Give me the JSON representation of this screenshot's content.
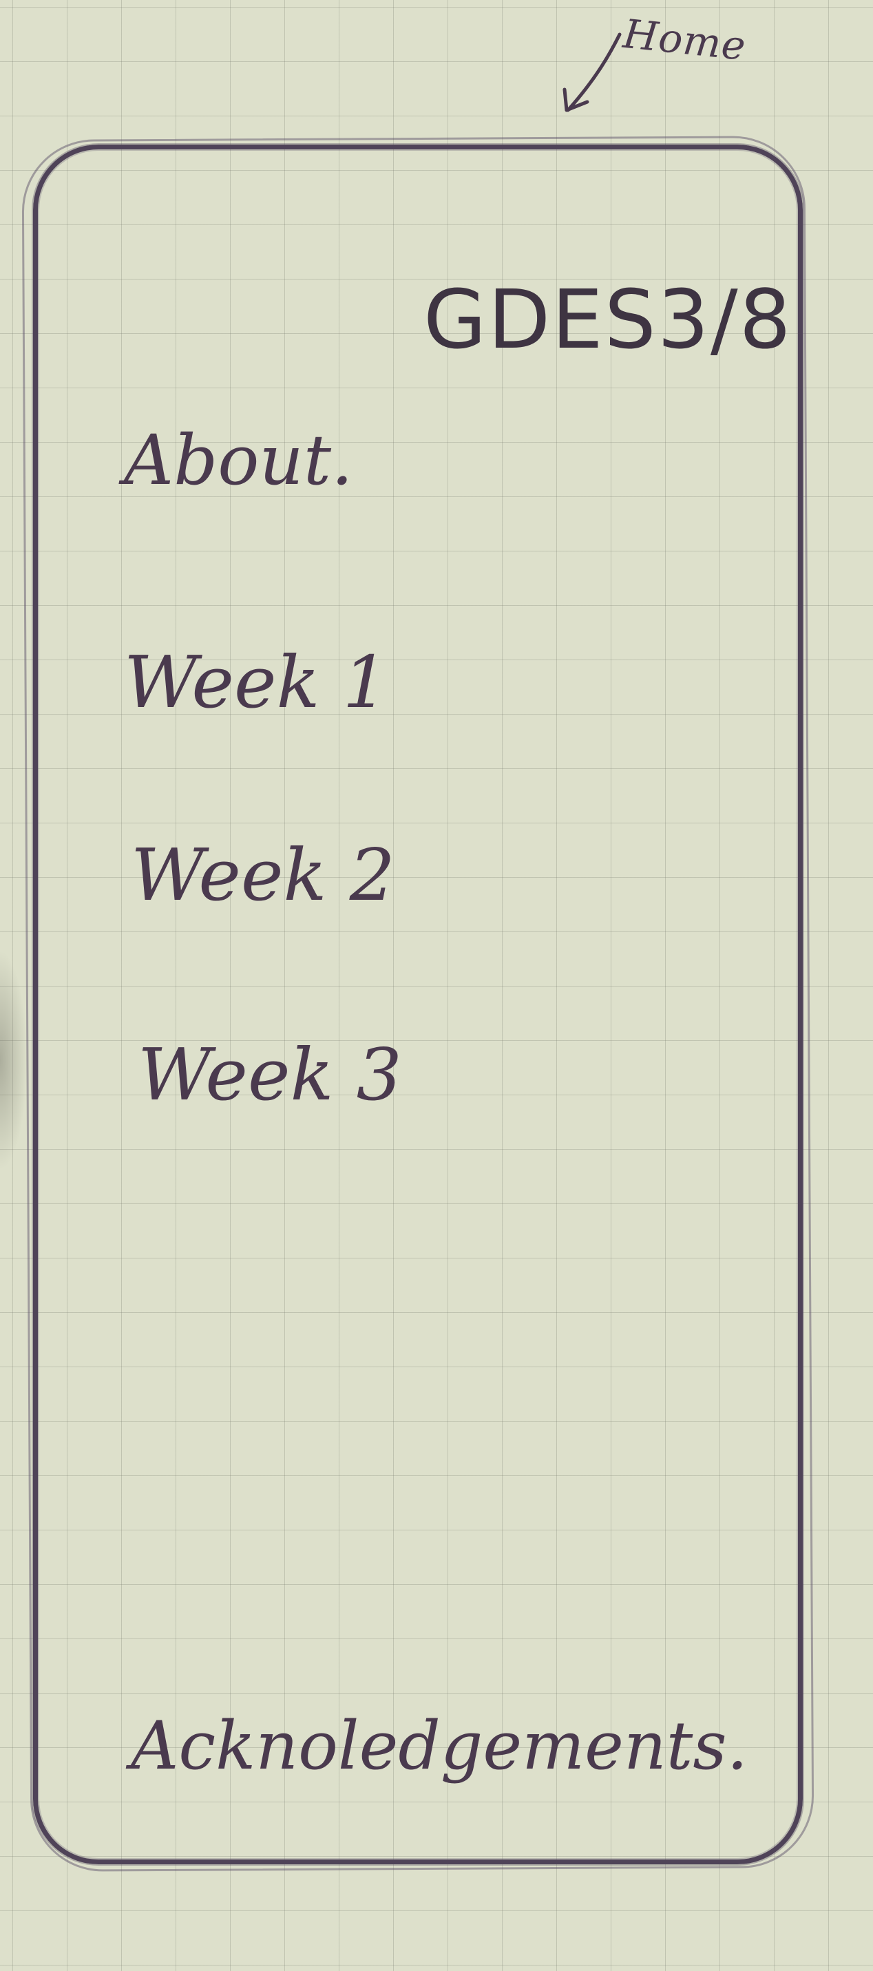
{
  "annotation": {
    "label": "Home"
  },
  "header": {
    "title": "GDES3/8"
  },
  "menu": {
    "items": [
      {
        "label": "About."
      },
      {
        "label": "Week 1"
      },
      {
        "label": "Week 2"
      },
      {
        "label": "Week 3"
      }
    ]
  },
  "footer": {
    "acknowledgements_label": "Acknoledgements."
  },
  "colors": {
    "paper": "#dde0cb",
    "ink": "#4a3a4e",
    "grid": "#8a8a80"
  }
}
